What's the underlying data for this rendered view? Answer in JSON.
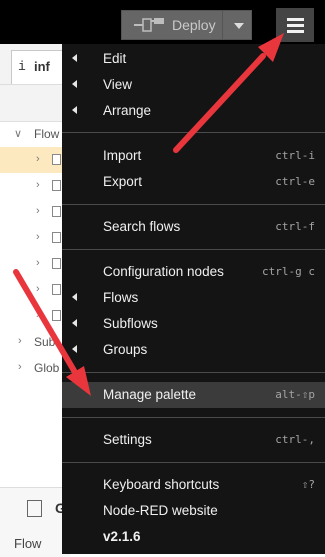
{
  "header": {
    "deploy_label": "Deploy"
  },
  "sidebar": {
    "info_tab_icon": "i",
    "info_tab_label": "inf",
    "tree": [
      {
        "chevron": "∨",
        "label": "Flow",
        "selected": false,
        "level": 0
      },
      {
        "chevron": "›",
        "label": "",
        "selected": true,
        "level": 1
      },
      {
        "chevron": "›",
        "label": "",
        "selected": false,
        "level": 1
      },
      {
        "chevron": "›",
        "label": "",
        "selected": false,
        "level": 1
      },
      {
        "chevron": "›",
        "label": "",
        "selected": false,
        "level": 1
      },
      {
        "chevron": "›",
        "label": "",
        "selected": false,
        "level": 1
      },
      {
        "chevron": "›",
        "label": "",
        "selected": false,
        "level": 1
      },
      {
        "chevron": "›",
        "label": "",
        "selected": false,
        "level": 1
      },
      {
        "chevron": "›",
        "label": "Sub",
        "selected": false,
        "level": 0
      },
      {
        "chevron": "›",
        "label": "Glob",
        "selected": false,
        "level": 0
      }
    ],
    "bottom_panel": {
      "title_fragment": "G",
      "flow_label": "Flow"
    }
  },
  "menu": {
    "items": [
      {
        "label": "Edit",
        "submenu": true,
        "shortcut": ""
      },
      {
        "label": "View",
        "submenu": true,
        "shortcut": ""
      },
      {
        "label": "Arrange",
        "submenu": true,
        "shortcut": ""
      },
      {
        "label": "Import",
        "submenu": false,
        "shortcut": "ctrl-i"
      },
      {
        "label": "Export",
        "submenu": false,
        "shortcut": "ctrl-e"
      },
      {
        "label": "Search flows",
        "submenu": false,
        "shortcut": "ctrl-f"
      },
      {
        "label": "Configuration nodes",
        "submenu": false,
        "shortcut": "ctrl-g c"
      },
      {
        "label": "Flows",
        "submenu": true,
        "shortcut": ""
      },
      {
        "label": "Subflows",
        "submenu": true,
        "shortcut": ""
      },
      {
        "label": "Groups",
        "submenu": true,
        "shortcut": ""
      },
      {
        "label": "Manage palette",
        "submenu": false,
        "shortcut": "alt-⇧p"
      },
      {
        "label": "Settings",
        "submenu": false,
        "shortcut": "ctrl-,"
      },
      {
        "label": "Keyboard shortcuts",
        "submenu": false,
        "shortcut": "⇧?"
      },
      {
        "label": "Node-RED website",
        "submenu": false,
        "shortcut": ""
      },
      {
        "label": "v2.1.6",
        "submenu": false,
        "shortcut": ""
      }
    ],
    "highlighted_item": "Manage palette"
  },
  "colors": {
    "header_bg": "#000000",
    "menu_bg": "#141414",
    "menu_highlight": "#3b3b3b",
    "selected_row": "#fde9c0",
    "annotation_arrow": "#e8363c"
  }
}
